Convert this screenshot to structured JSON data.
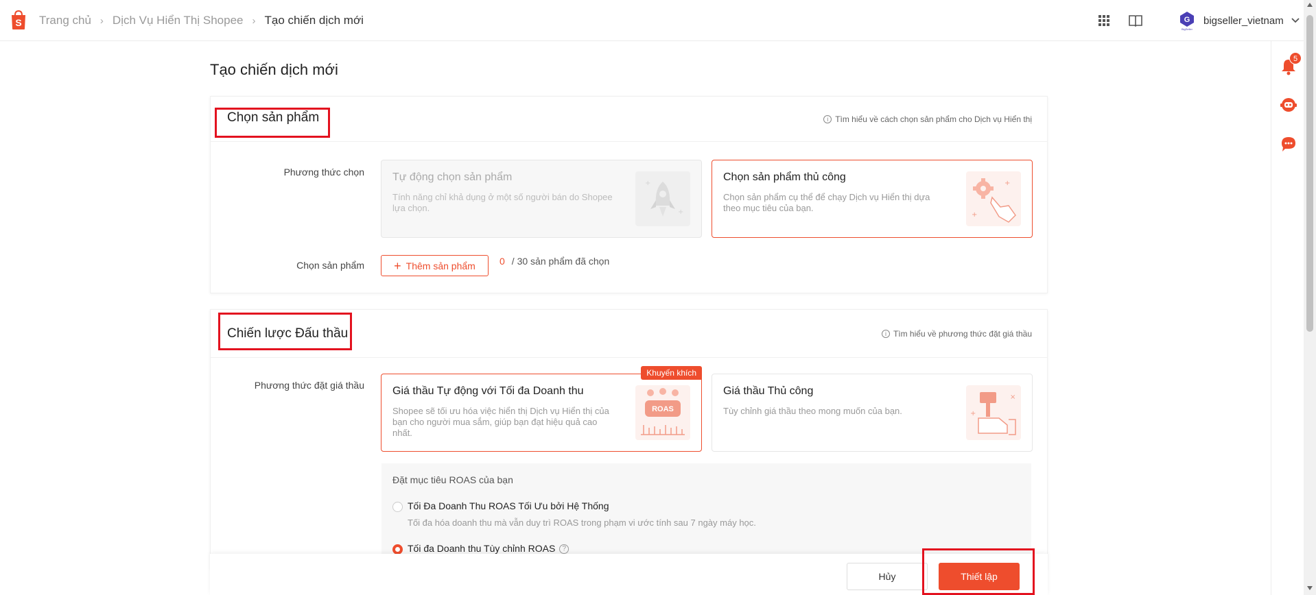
{
  "breadcrumb": {
    "items": [
      "Trang chủ",
      "Dịch Vụ Hiển Thị Shopee",
      "Tạo chiến dịch mới"
    ]
  },
  "header": {
    "username": "bigseller_vietnam"
  },
  "sidebar": {
    "notification_count": "5"
  },
  "page": {
    "title": "Tạo chiến dịch mới"
  },
  "product_section": {
    "title": "Chọn sản phẩm",
    "help": "Tìm hiểu về cách chọn sản phẩm cho Dịch vụ Hiển thị",
    "method_label": "Phương thức chọn",
    "options": [
      {
        "title": "Tự động chọn sản phẩm",
        "desc": "Tính năng chỉ khả dụng ở một số người bán do Shopee lựa chọn.",
        "state": "disabled"
      },
      {
        "title": "Chọn sản phẩm thủ công",
        "desc": "Chọn sản phẩm cụ thể để chạy Dịch vụ Hiển thị dựa theo mục tiêu của bạn.",
        "state": "selected"
      }
    ],
    "select_label": "Chọn sản phẩm",
    "add_button": "Thêm sản phẩm",
    "selected_count": "0",
    "selected_suffix": "/ 30 sản phẩm đã chọn"
  },
  "bidding_section": {
    "title": "Chiến lược Đấu thầu",
    "help": "Tìm hiểu về phương thức đặt giá thầu",
    "method_label": "Phương thức đặt giá thầu",
    "options": [
      {
        "title": "Giá thầu Tự động với Tối đa Doanh thu",
        "desc": "Shopee sẽ tối ưu hóa việc hiển thị Dịch vụ Hiển thị của bạn cho người mua sắm, giúp bạn đạt hiệu quả cao nhất.",
        "ribbon": "Khuyến khích",
        "state": "selected"
      },
      {
        "title": "Giá thầu Thủ công",
        "desc": "Tùy chỉnh giá thầu theo mong muốn của bạn.",
        "state": "normal"
      }
    ],
    "roas": {
      "title": "Đặt mục tiêu ROAS của bạn",
      "options": [
        {
          "label": "Tối Đa Doanh Thu ROAS Tối Ưu bởi Hệ Thống",
          "desc": "Tối đa hóa doanh thu mà vẫn duy trì ROAS trong phạm vi ước tính sau 7 ngày máy học.",
          "checked": false
        },
        {
          "label": "Tối đa Doanh thu Tùy chỉnh ROAS",
          "checked": true
        }
      ],
      "illus_text": "ROAS"
    }
  },
  "footer": {
    "cancel": "Hủy",
    "submit": "Thiết lập"
  },
  "colors": {
    "accent": "#ee4d2d",
    "highlight_box": "#e3121f"
  }
}
